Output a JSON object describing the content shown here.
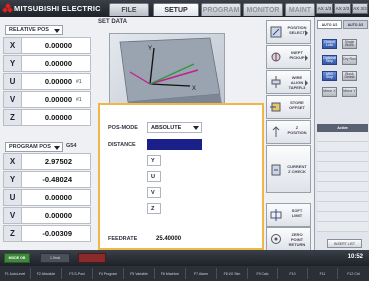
{
  "header": {
    "brand": "MITSUBISHI ELECTRIC",
    "tabs": [
      {
        "label": "FILE",
        "state": "normal"
      },
      {
        "label": "SETUP",
        "state": "active"
      },
      {
        "label": "PROGRAM",
        "state": "disabled"
      },
      {
        "label": "MONITOR",
        "state": "disabled"
      },
      {
        "label": "MAINT",
        "state": "disabled"
      }
    ],
    "small_buttons": [
      "AX 1/3",
      "AX 2/3",
      "AX 3/3"
    ]
  },
  "relative_pos": {
    "title": "RELATIVE POS",
    "rows": [
      {
        "axis": "X",
        "value": "0.00000",
        "tag": ""
      },
      {
        "axis": "Y",
        "value": "0.00000",
        "tag": ""
      },
      {
        "axis": "U",
        "value": "0.00000",
        "tag": "#1"
      },
      {
        "axis": "V",
        "value": "0.00000",
        "tag": "#1"
      },
      {
        "axis": "Z",
        "value": "0.00000",
        "tag": ""
      }
    ]
  },
  "program_pos": {
    "title": "PROGRAM POS",
    "code": "G54",
    "rows": [
      {
        "axis": "X",
        "value": "2.97502"
      },
      {
        "axis": "Y",
        "value": "-0.48024"
      },
      {
        "axis": "U",
        "value": "0.00000"
      },
      {
        "axis": "V",
        "value": "0.00000"
      },
      {
        "axis": "Z",
        "value": "-0.00309"
      }
    ]
  },
  "set_data": {
    "label": "SET DATA",
    "pos_mode_label": "POS-MODE",
    "pos_mode_value": "ABSOLUTE",
    "distance_label": "DISTANCE",
    "axes": [
      "Y",
      "U",
      "V",
      "Z"
    ],
    "feedrate_label": "FEEDRATE",
    "feedrate_value": "25.40000"
  },
  "softkeys": [
    {
      "label": "POSITION\nSELECT"
    },
    {
      "label": "INEPT\nPICKUP"
    },
    {
      "label": "WIRE\nALIGN\nTAPER-3"
    },
    {
      "label": "STORE\nOFFSET"
    },
    {
      "label": "Z\nPOSITION"
    },
    {
      "label": "CURRENT\nZ CHECK"
    },
    {
      "label": "SOFT\nLIMIT"
    },
    {
      "label": "ZERO\nPOINT\nRETURN"
    }
  ],
  "right_panel": {
    "tabs": [
      "AUTO 1/2",
      "AUTO 2/2"
    ],
    "buttons": [
      "Output Lock",
      "Single Block",
      "Optional Skip",
      "Dry Run",
      "M00 Stop",
      "Block Delete",
      "Mirror X",
      "Mirror Y"
    ],
    "list_header": "Active",
    "footer": "INSERT LIST"
  },
  "status_bar": {
    "left": "MODE OB",
    "center": "1.0mA",
    "time": "10:52"
  },
  "function_keys": [
    "F1 AutoLevel",
    "F2 Absolute",
    "F3 S-Posi",
    "F4 Program",
    "F5 Variable",
    "F6 Machine",
    "F7 Alarm",
    "F8 I/O Sim",
    "F9 Calc",
    "F10",
    "F11",
    "F12 Ctrl"
  ]
}
